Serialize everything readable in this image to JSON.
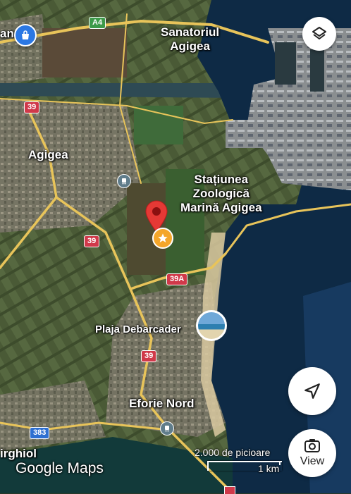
{
  "places": {
    "sanatoriul": "Sanatoriul\nAgigea",
    "agigea": "Agigea",
    "statiunea": "Stațiunea\nZoologică\nMarină Agigea",
    "plaja": "Plaja Debarcader",
    "eforie": "Eforie Nord",
    "irghiol": "irghiol",
    "an_partial": "an"
  },
  "roads": {
    "a4": "A4",
    "r39_top": "39",
    "r39_mid": "39",
    "r39a": "39A",
    "r39_bot": "39",
    "r383": "383"
  },
  "branding": {
    "logo": "Google Maps"
  },
  "scale": {
    "top": "2.000 de picioare",
    "bottom": "1 km"
  },
  "controls": {
    "view_label": "View"
  },
  "colors": {
    "water": "#0e2a45",
    "road": "#e8c45a",
    "pin": "#e53935",
    "star_marker": "#f4a62a"
  }
}
